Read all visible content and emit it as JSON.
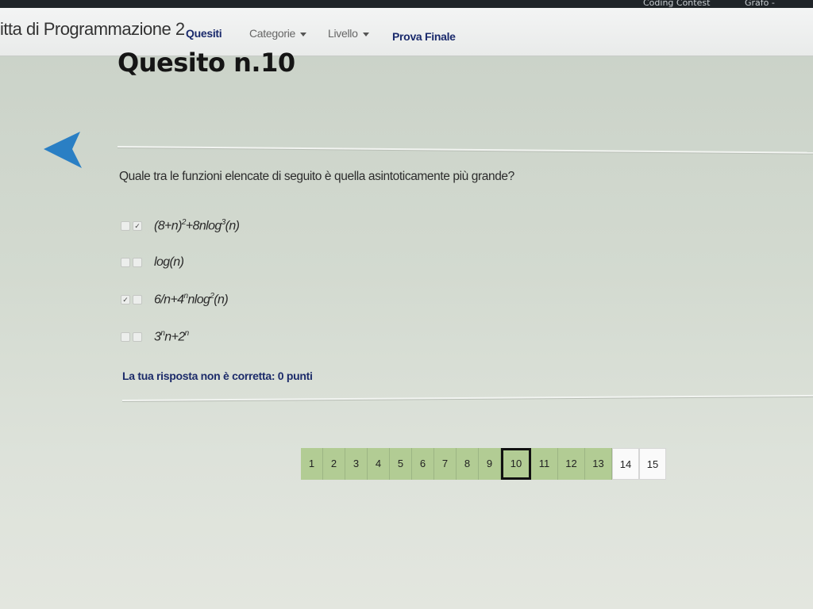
{
  "browser": {
    "tabs": [
      "Coding Contest",
      "Grafo - Wikipe..."
    ]
  },
  "navbar": {
    "brand": "itta di Programmazione 2",
    "items": {
      "quesiti": "Quesiti",
      "categorie": "Categorie",
      "livello": "Livello",
      "prova_finale": "Prova Finale"
    }
  },
  "question": {
    "title": "Quesito n.10",
    "text": "Quale tra le funzioni elencate di seguito è quella asintoticamente più grande?",
    "options": [
      {
        "marks": [
          "",
          "✓"
        ]
      },
      {
        "marks": [
          "",
          ""
        ]
      },
      {
        "marks": [
          "✓",
          ""
        ]
      },
      {
        "marks": [
          "",
          ""
        ]
      }
    ]
  },
  "feedback": "La tua risposta non è corretta: 0 punti",
  "pagination": {
    "pages": [
      "1",
      "2",
      "3",
      "4",
      "5",
      "6",
      "7",
      "8",
      "9",
      "10",
      "11",
      "12",
      "13",
      "14",
      "15"
    ],
    "current": "10",
    "answered_color": "#b2cc94",
    "unanswered_color": "#fafafa"
  },
  "colors": {
    "accent_arrow": "#2a7fc4",
    "feedback_text": "#1c2b6a"
  },
  "icons": {
    "back": "back-arrow-icon",
    "dropdown": "caret-down-icon"
  }
}
